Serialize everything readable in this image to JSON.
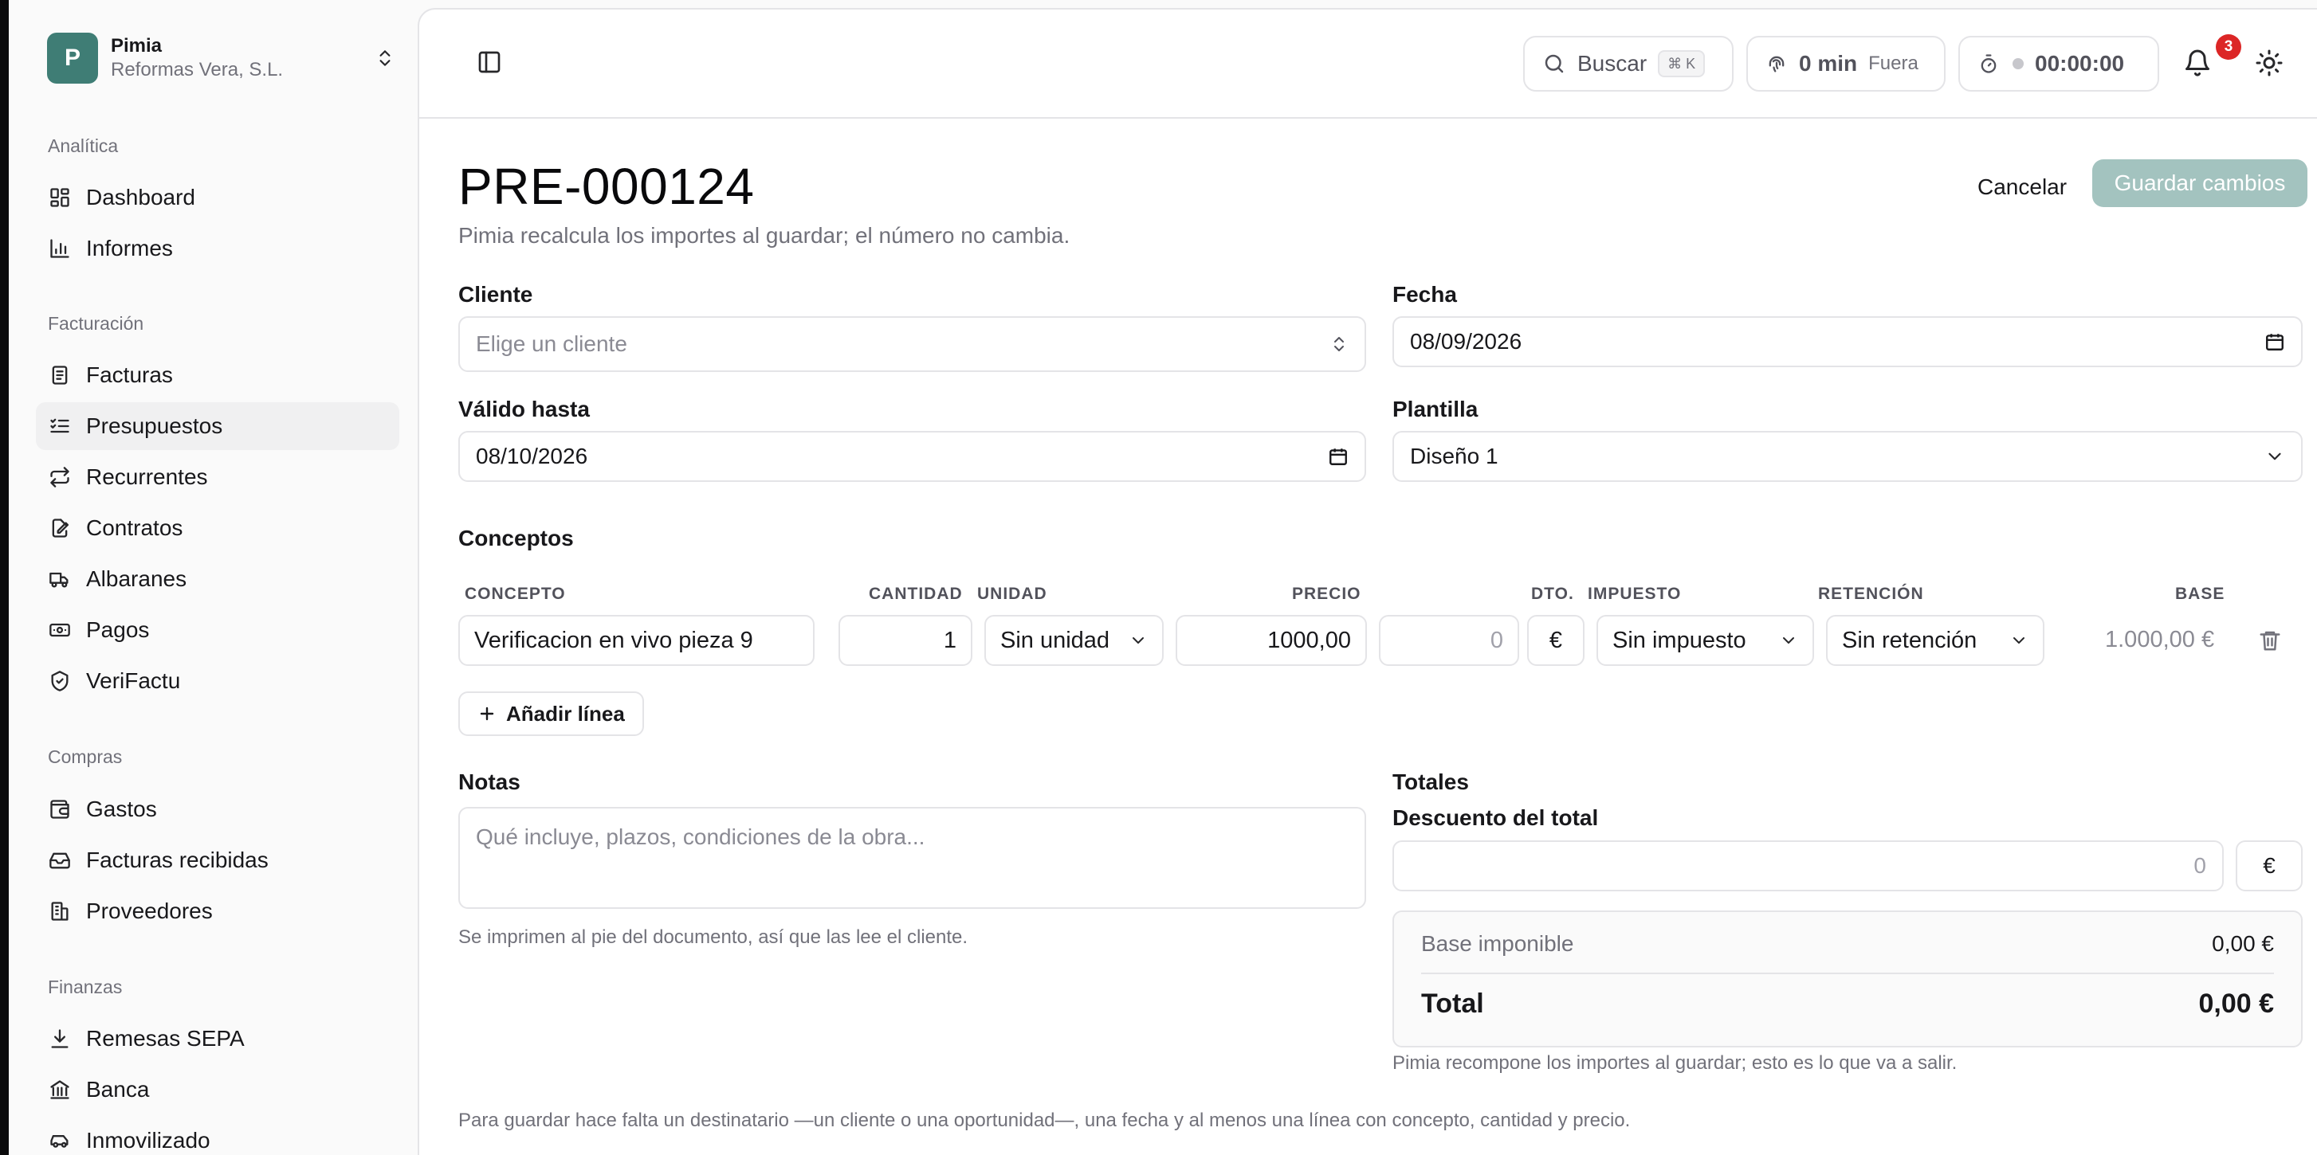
{
  "org": {
    "initial": "P",
    "name": "Pimia",
    "company": "Reformas Vera, S.L."
  },
  "sidebar": {
    "groups": [
      {
        "label": "Analítica",
        "items": [
          {
            "label": "Dashboard",
            "icon": "dashboard-icon"
          },
          {
            "label": "Informes",
            "icon": "bar-chart-icon"
          }
        ]
      },
      {
        "label": "Facturación",
        "items": [
          {
            "label": "Facturas",
            "icon": "document-icon"
          },
          {
            "label": "Presupuestos",
            "icon": "list-check-icon",
            "active": true
          },
          {
            "label": "Recurrentes",
            "icon": "repeat-icon"
          },
          {
            "label": "Contratos",
            "icon": "file-edit-icon"
          },
          {
            "label": "Albaranes",
            "icon": "truck-icon"
          },
          {
            "label": "Pagos",
            "icon": "banknote-icon"
          },
          {
            "label": "VeriFactu",
            "icon": "shield-check-icon"
          }
        ]
      },
      {
        "label": "Compras",
        "items": [
          {
            "label": "Gastos",
            "icon": "wallet-icon"
          },
          {
            "label": "Facturas recibidas",
            "icon": "inbox-icon"
          },
          {
            "label": "Proveedores",
            "icon": "building-icon"
          }
        ]
      },
      {
        "label": "Finanzas",
        "items": [
          {
            "label": "Remesas SEPA",
            "icon": "download-icon"
          },
          {
            "label": "Banca",
            "icon": "bank-icon"
          },
          {
            "label": "Inmovilizado",
            "icon": "car-icon"
          }
        ]
      }
    ]
  },
  "topbar": {
    "search_label": "Buscar",
    "search_kbd": "⌘ K",
    "clock_minutes": "0 min",
    "clock_status": "Fuera",
    "timer": "00:00:00",
    "notifications_count": "3"
  },
  "form": {
    "title": "PRE-000124",
    "subtitle": "Pimia recalcula los importes al guardar; el número no cambia.",
    "cancel_label": "Cancelar",
    "save_label": "Guardar cambios",
    "client_label": "Cliente",
    "client_placeholder": "Elige un cliente",
    "date_label": "Fecha",
    "date_value": "08/09/2026",
    "valid_label": "Válido hasta",
    "valid_value": "08/10/2026",
    "template_label": "Plantilla",
    "template_value": "Diseño 1",
    "concepts_label": "Conceptos",
    "columns": {
      "concept": "CONCEPTO",
      "quantity": "CANTIDAD",
      "unit": "UNIDAD",
      "price": "PRECIO",
      "discount": "DTO.",
      "tax": "IMPUESTO",
      "retention": "RETENCIÓN",
      "base": "BASE"
    },
    "line": {
      "concept": "Verificacion en vivo pieza 9",
      "quantity": "1",
      "unit": "Sin unidad",
      "price": "1000,00",
      "discount": "0",
      "discount_type": "€",
      "tax": "Sin impuesto",
      "retention": "Sin retención",
      "base": "1.000,00 €"
    },
    "add_line_label": "Añadir línea",
    "notes_label": "Notas",
    "notes_placeholder": "Qué incluye, plazos, condiciones de la obra...",
    "notes_hint": "Se imprimen al pie del documento, así que las lee el cliente.",
    "totals_label": "Totales",
    "total_discount_label": "Descuento del total",
    "total_discount_value": "0",
    "total_discount_type": "€",
    "taxable_base_label": "Base imponible",
    "taxable_base_value": "0,00 €",
    "total_label": "Total",
    "total_value": "0,00 €",
    "totals_hint": "Pimia recompone los importes al guardar; esto es lo que va a salir.",
    "footer_hint": "Para guardar hace falta un destinatario —un cliente o una oportunidad—, una fecha y al menos una línea con concepto, cantidad y precio."
  },
  "colors": {
    "accent": "#3f7d75",
    "save_disabled": "#a3c3bf",
    "badge": "#dc2626"
  }
}
